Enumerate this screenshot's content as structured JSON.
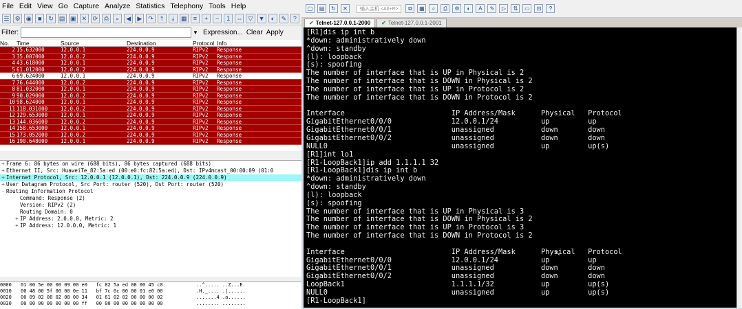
{
  "wireshark": {
    "menu": [
      "File",
      "Edit",
      "View",
      "Go",
      "Capture",
      "Analyze",
      "Statistics",
      "Telephony",
      "Tools",
      "Help"
    ],
    "filter": {
      "label": "Filter:",
      "value": "",
      "expression": "Expression...",
      "clear": "Clear",
      "apply": "Apply"
    },
    "columns": {
      "no": "No.",
      "time": "Time",
      "source": "Source",
      "destination": "Destination",
      "protocol": "Protocol",
      "info": "Info"
    },
    "packets": [
      {
        "no": "2",
        "time": "15.632000",
        "src": "12.0.0.1",
        "dst": "224.0.0.9",
        "proto": "RIPv2",
        "info": "Response"
      },
      {
        "no": "3",
        "time": "35.007000",
        "src": "12.0.0.2",
        "dst": "224.0.0.9",
        "proto": "RIPv2",
        "info": "Response"
      },
      {
        "no": "4",
        "time": "43.618000",
        "src": "12.0.0.1",
        "dst": "224.0.0.9",
        "proto": "RIPv2",
        "info": "Response"
      },
      {
        "no": "5",
        "time": "61.012000",
        "src": "12.0.0.2",
        "dst": "224.0.0.9",
        "proto": "RIPv2",
        "info": "Response"
      },
      {
        "no": "6",
        "time": "69.624000",
        "src": "12.0.0.1",
        "dst": "224.0.0.9",
        "proto": "RIPv2",
        "info": "Response",
        "selected": true
      },
      {
        "no": "7",
        "time": "76.644000",
        "src": "12.0.0.2",
        "dst": "224.0.0.9",
        "proto": "RIPv2",
        "info": "Response"
      },
      {
        "no": "8",
        "time": "81.032000",
        "src": "12.0.0.1",
        "dst": "224.0.0.9",
        "proto": "RIPv2",
        "info": "Response"
      },
      {
        "no": "9",
        "time": "90.029000",
        "src": "12.0.0.2",
        "dst": "224.0.0.9",
        "proto": "RIPv2",
        "info": "Response"
      },
      {
        "no": "10",
        "time": "98.624000",
        "src": "12.0.0.1",
        "dst": "224.0.0.9",
        "proto": "RIPv2",
        "info": "Response"
      },
      {
        "no": "11",
        "time": "118.031000",
        "src": "12.0.0.2",
        "dst": "224.0.0.9",
        "proto": "RIPv2",
        "info": "Response"
      },
      {
        "no": "12",
        "time": "129.653000",
        "src": "12.0.0.1",
        "dst": "224.0.0.9",
        "proto": "RIPv2",
        "info": "Response"
      },
      {
        "no": "13",
        "time": "144.036000",
        "src": "12.0.0.2",
        "dst": "224.0.0.9",
        "proto": "RIPv2",
        "info": "Response"
      },
      {
        "no": "14",
        "time": "158.653000",
        "src": "12.0.0.1",
        "dst": "224.0.0.9",
        "proto": "RIPv2",
        "info": "Response"
      },
      {
        "no": "15",
        "time": "173.052000",
        "src": "12.0.0.2",
        "dst": "224.0.0.9",
        "proto": "RIPv2",
        "info": "Response"
      },
      {
        "no": "16",
        "time": "190.648000",
        "src": "12.0.0.1",
        "dst": "224.0.0.9",
        "proto": "RIPv2",
        "info": "Response"
      }
    ],
    "details": [
      {
        "text": "Frame 6: 86 bytes on wire (688 bits), 86 bytes captured (688 bits)",
        "exp": "+",
        "level": 0
      },
      {
        "text": "Ethernet II, Src: HuaweiTe_82:5a:ed (00:e0:fc:82:5a:ed), Dst: IPv4mcast_00:00:09 (01:0",
        "exp": "+",
        "level": 0
      },
      {
        "text": "Internet Protocol, Src: 12.0.0.1 (12.0.0.1), Dst: 224.0.0.9 (224.0.0.9)",
        "exp": "+",
        "level": 0,
        "highlight": true
      },
      {
        "text": "User Datagram Protocol, Src Port: router (520), Dst Port: router (520)",
        "exp": "+",
        "level": 0
      },
      {
        "text": "Routing Information Protocol",
        "exp": "-",
        "level": 0
      },
      {
        "text": "Command: Response (2)",
        "exp": "",
        "level": 1
      },
      {
        "text": "Version: RIPv2 (2)",
        "exp": "",
        "level": 1
      },
      {
        "text": "Routing Domain: 0",
        "exp": "",
        "level": 1
      },
      {
        "text": "IP Address: 2.0.0.0, Metric: 2",
        "exp": "+",
        "level": 1
      },
      {
        "text": "IP Address: 12.0.0.0, Metric: 1",
        "exp": "+",
        "level": 1
      }
    ],
    "hex": [
      {
        "off": "0000",
        "hex": "01 00 5e 00 00 09 00 e0   fc 82 5a ed 08 00 45 c0",
        "ascii": "..^..... ..Z...E."
      },
      {
        "off": "0010",
        "hex": "00 48 00 5f 00 00 0e 11   bf 7c 0c 00 00 01 e0 00",
        "ascii": ".H._.... .|......"
      },
      {
        "off": "0020",
        "hex": "00 09 02 08 02 08 00 34   01 61 02 02 00 00 00 02",
        "ascii": ".......4 .a......"
      },
      {
        "off": "0030",
        "hex": "00 00 00 00 00 00 00 ff   00 00 00 00 00 00 00 00",
        "ascii": "........ ........"
      }
    ]
  },
  "terminal": {
    "toolbar_hint": "输入主机 <Alt+R>",
    "tabs": [
      {
        "label": "Telnet-127.0.0.1-2000",
        "active": true
      },
      {
        "label": "Telnet-127.0.0.1-2001",
        "active": false
      }
    ],
    "lines": [
      "[R1]dis ip int b",
      "*down: administratively down",
      "^down: standby",
      "(l): loopback",
      "(s): spoofing",
      "The number of interface that is UP in Physical is 2",
      "The number of interface that is DOWN in Physical is 2",
      "The number of interface that is UP in Protocol is 2",
      "The number of interface that is DOWN in Protocol is 2",
      "",
      "Interface                         IP Address/Mask      Physical   Protocol",
      "GigabitEthernet0/0/0              12.0.0.1/24          up         up",
      "GigabitEthernet0/0/1              unassigned           down       down",
      "GigabitEthernet0/0/2              unassigned           down       down",
      "NULL0                             unassigned           up         up(s)",
      "[R1]int lo1",
      "[R1-LoopBack1]ip add 1.1.1.1 32",
      "[R1-LoopBack1]dis ip int b",
      "*down: administratively down",
      "^down: standby",
      "(l): loopback",
      "(s): spoofing",
      "The number of interface that is UP in Physical is 3",
      "The number of interface that is DOWN in Physical is 2",
      "The number of interface that is UP in Protocol is 3",
      "The number of interface that is DOWN in Protocol is 2",
      "",
      "Interface                         IP Address/Mask      Physical   Protocol",
      "GigabitEthernet0/0/0              12.0.0.1/24          up         up",
      "GigabitEthernet0/0/1              unassigned           down       down",
      "GigabitEthernet0/0/2              unassigned           down       down",
      "LoopBack1                         1.1.1.1/32           up         up(s)",
      "NULL0                             unassigned           up         up(s)",
      "[R1-LoopBack1]"
    ]
  }
}
